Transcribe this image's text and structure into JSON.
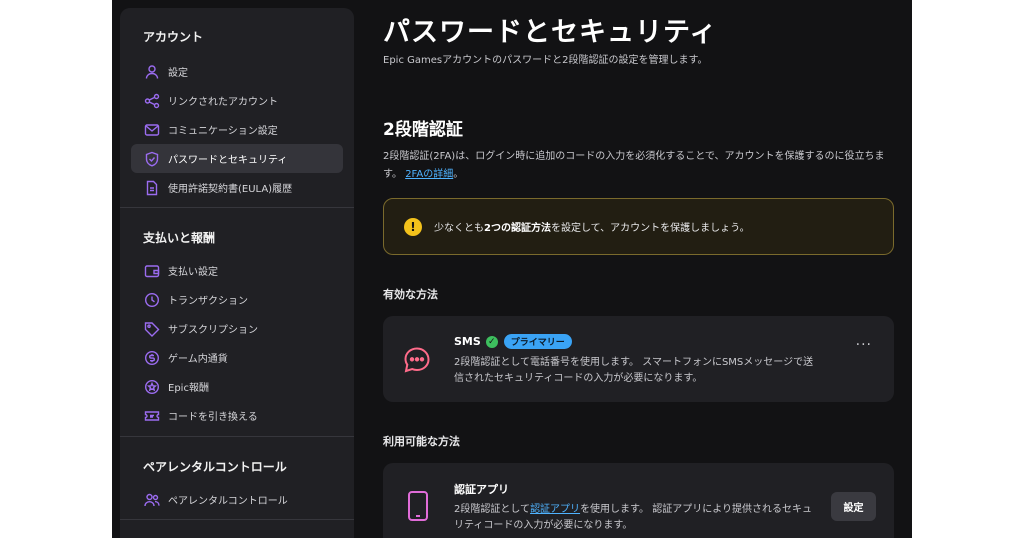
{
  "sidebar": {
    "account_title": "アカウント",
    "account_items": [
      {
        "label": "設定",
        "icon": "person-icon"
      },
      {
        "label": "リンクされたアカウント",
        "icon": "share-nodes-icon"
      },
      {
        "label": "コミュニケーション設定",
        "icon": "mail-icon"
      },
      {
        "label": "パスワードとセキュリティ",
        "icon": "shield-icon",
        "active": true
      },
      {
        "label": "使用許諾契約書(EULA)履歴",
        "icon": "document-icon"
      }
    ],
    "payments_title": "支払いと報酬",
    "payment_items": [
      {
        "label": "支払い設定",
        "icon": "wallet-icon"
      },
      {
        "label": "トランザクション",
        "icon": "clock-icon"
      },
      {
        "label": "サブスクリプション",
        "icon": "tag-icon"
      },
      {
        "label": "ゲーム内通貨",
        "icon": "coin-icon"
      },
      {
        "label": "Epic報酬",
        "icon": "reward-icon"
      },
      {
        "label": "コードを引き換える",
        "icon": "ticket-icon"
      }
    ],
    "parental_title": "ペアレンタルコントロール",
    "parental_items": [
      {
        "label": "ペアレンタルコントロール",
        "icon": "users-icon"
      }
    ]
  },
  "main": {
    "title": "パスワードとセキュリティ",
    "subtitle": "Epic Gamesアカウントのパスワードと2段階認証の設定を管理します。",
    "twofa_heading": "2段階認証",
    "twofa_desc": "2段階認証(2FA)は、ログイン時に追加のコードの入力を必須化することで、アカウントを保護するのに役立ちます。",
    "twofa_link": "2FAの詳細",
    "twofa_desc_end": "。",
    "warning_pre": "少なくとも",
    "warning_bold": "2つの認証方法",
    "warning_post": "を設定して、アカウントを保護しましょう。",
    "enabled_heading": "有効な方法",
    "sms": {
      "title": "SMS",
      "badge": "プライマリー",
      "text": "2段階認証として電話番号を使用します。 スマートフォンにSMSメッセージで送信されたセキュリティコードの入力が必要になります。",
      "more": "···"
    },
    "available_heading": "利用可能な方法",
    "app": {
      "title": "認証アプリ",
      "text_pre": "2段階認証として",
      "text_link": "認証アプリ",
      "text_post": "を使用します。 認証アプリにより提供されるセキュリティコードの入力が必要になります。",
      "button": "設定"
    }
  },
  "colors": {
    "accent_purple": "#9b6cf0",
    "accent_blue": "#4fb3ff",
    "warning_yellow": "#f3c21b",
    "success_green": "#3dbf5e",
    "sms_icon_pink": "#ff6b8a",
    "app_icon_pink": "#e06cd8"
  }
}
